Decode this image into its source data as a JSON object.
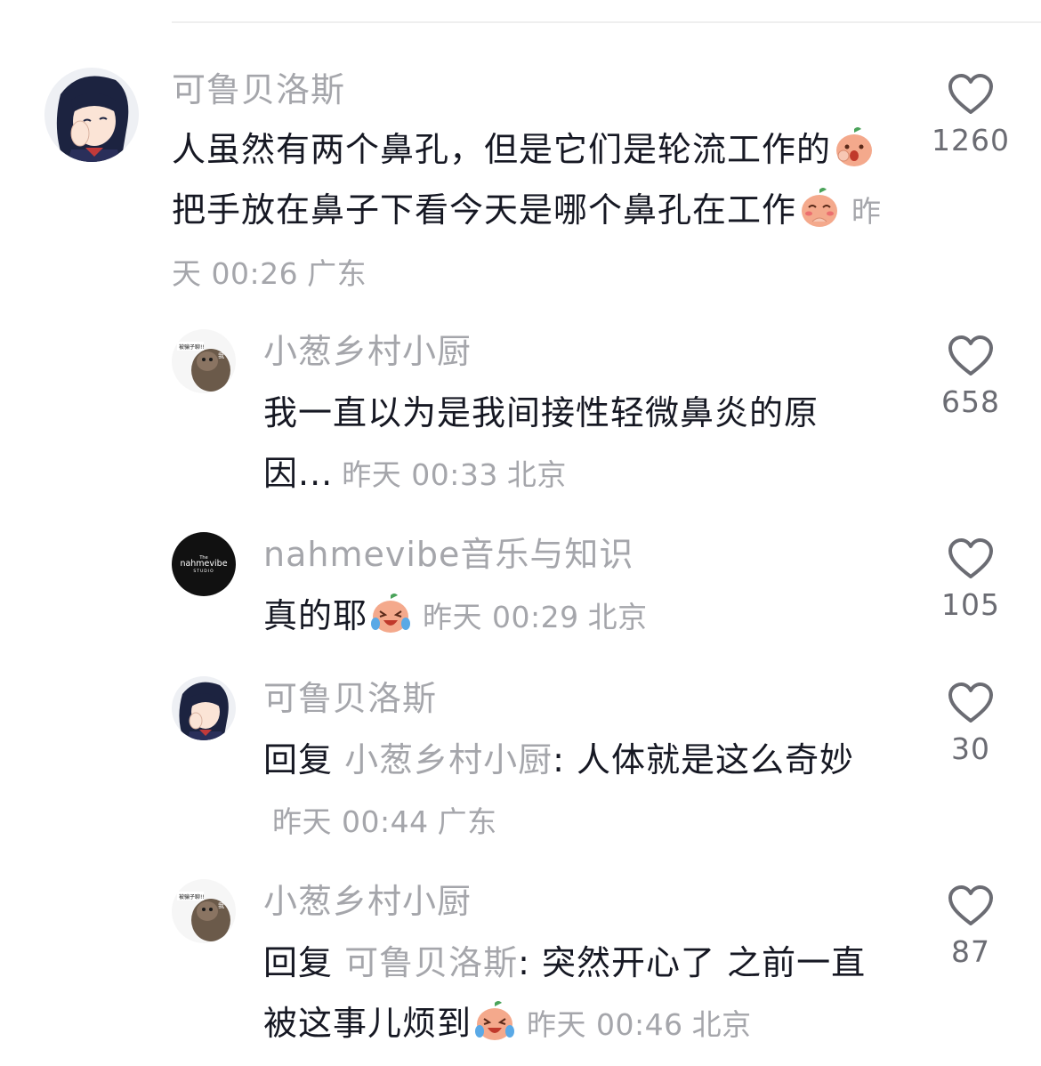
{
  "comments": [
    {
      "name": "可鲁贝洛斯",
      "text_before": "人虽然有两个鼻孔，但是它们是轮流工作的",
      "text_after": "把手放在鼻子下看今天是哪个鼻孔在工作",
      "time": "昨天 00:26",
      "location": "广东",
      "likes": "1260",
      "emoji_1": "shocked-peach-emoji",
      "emoji_2": "shy-peach-emoji"
    },
    {
      "name": "小葱乡村小厨",
      "text": "我一直以为是我间接性轻微鼻炎的原因...",
      "time": "昨天 00:33",
      "location": "北京",
      "likes": "658",
      "avatar_caption_1": "被骗子聊!!",
      "avatar_caption_2": "我"
    },
    {
      "name": "nahmevibe音乐与知识",
      "text": "真的耶",
      "time": "昨天 00:29",
      "location": "北京",
      "likes": "105",
      "emoji": "laugh-cry-peach-emoji",
      "avatar_logo_small": "The",
      "avatar_logo": "nahmevibe",
      "avatar_logo_sub": "STUDIO"
    },
    {
      "name": "可鲁贝洛斯",
      "reply_prefix": "回复 ",
      "reply_to": "小葱乡村小厨",
      "text": ": 人体就是这么奇妙",
      "time": "昨天 00:44",
      "location": "广东",
      "likes": "30"
    },
    {
      "name": "小葱乡村小厨",
      "reply_prefix": "回复 ",
      "reply_to": "可鲁贝洛斯",
      "text": ": 突然开心了 之前一直被这事儿烦到",
      "time": "昨天 00:46",
      "location": "北京",
      "likes": "87",
      "emoji": "laugh-cry-peach-emoji",
      "avatar_caption_1": "被骗子聊!!",
      "avatar_caption_2": "我"
    }
  ],
  "colors": {
    "primary_text": "#161823",
    "secondary_text": "#a5a6ab",
    "like_count": "#6b6c73",
    "heart_stroke": "#6b6c73",
    "peach_emoji": "#f4a98c"
  }
}
